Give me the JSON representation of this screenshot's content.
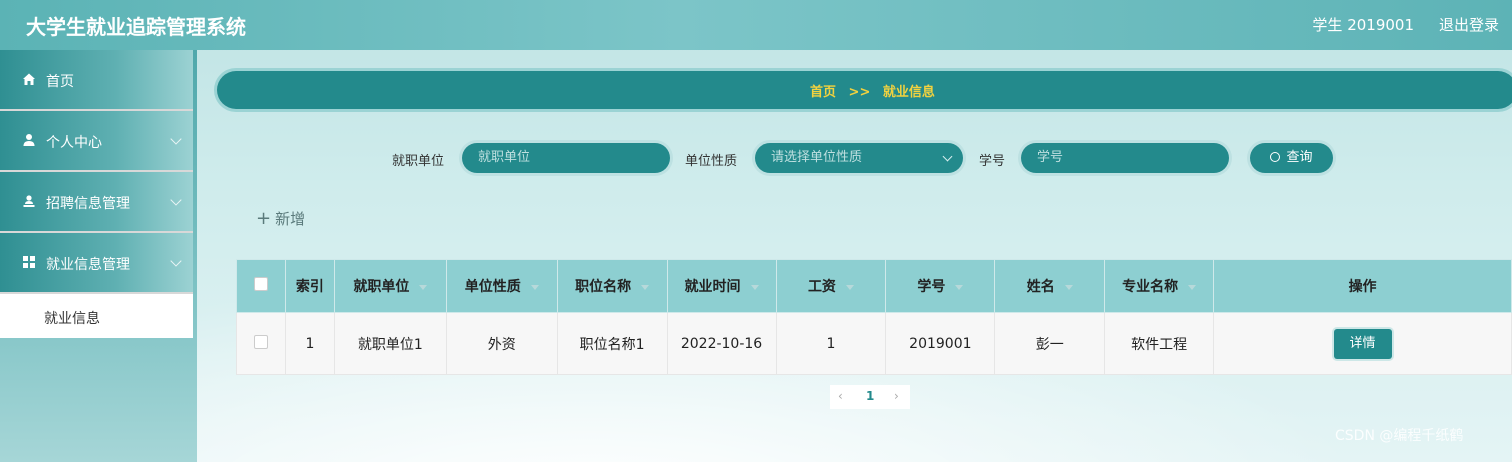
{
  "header": {
    "title": "大学生就业追踪管理系统",
    "user": "学生 2019001",
    "logout": "退出登录"
  },
  "sidebar": {
    "items": [
      {
        "label": "首页"
      },
      {
        "label": "个人中心"
      },
      {
        "label": "招聘信息管理"
      },
      {
        "label": "就业信息管理"
      }
    ],
    "sub_item": "就业信息"
  },
  "breadcrumb": {
    "home": "首页",
    "sep": ">>",
    "current": "就业信息"
  },
  "search": {
    "unit_label": "就职单位",
    "unit_placeholder": "就职单位",
    "nature_label": "单位性质",
    "nature_placeholder": "请选择单位性质",
    "sid_label": "学号",
    "sid_placeholder": "学号",
    "query": "查询"
  },
  "add_label": "新增",
  "table": {
    "headers": [
      "索引",
      "就职单位",
      "单位性质",
      "职位名称",
      "就业时间",
      "工资",
      "学号",
      "姓名",
      "专业名称",
      "操作"
    ],
    "rows": [
      {
        "index": "1",
        "unit": "就职单位1",
        "nature": "外资",
        "position": "职位名称1",
        "date": "2022-10-16",
        "salary": "1",
        "sid": "2019001",
        "name": "彭一",
        "major": "软件工程",
        "action": "详情"
      }
    ]
  },
  "pagination": {
    "prev": "‹",
    "current": "1",
    "next": "›"
  },
  "watermark": "CSDN @编程千纸鹤",
  "colors": {
    "primary": "#238a8c",
    "breadcrumb_text": "#f2d23f",
    "header_bg": "#6bbcbe"
  }
}
